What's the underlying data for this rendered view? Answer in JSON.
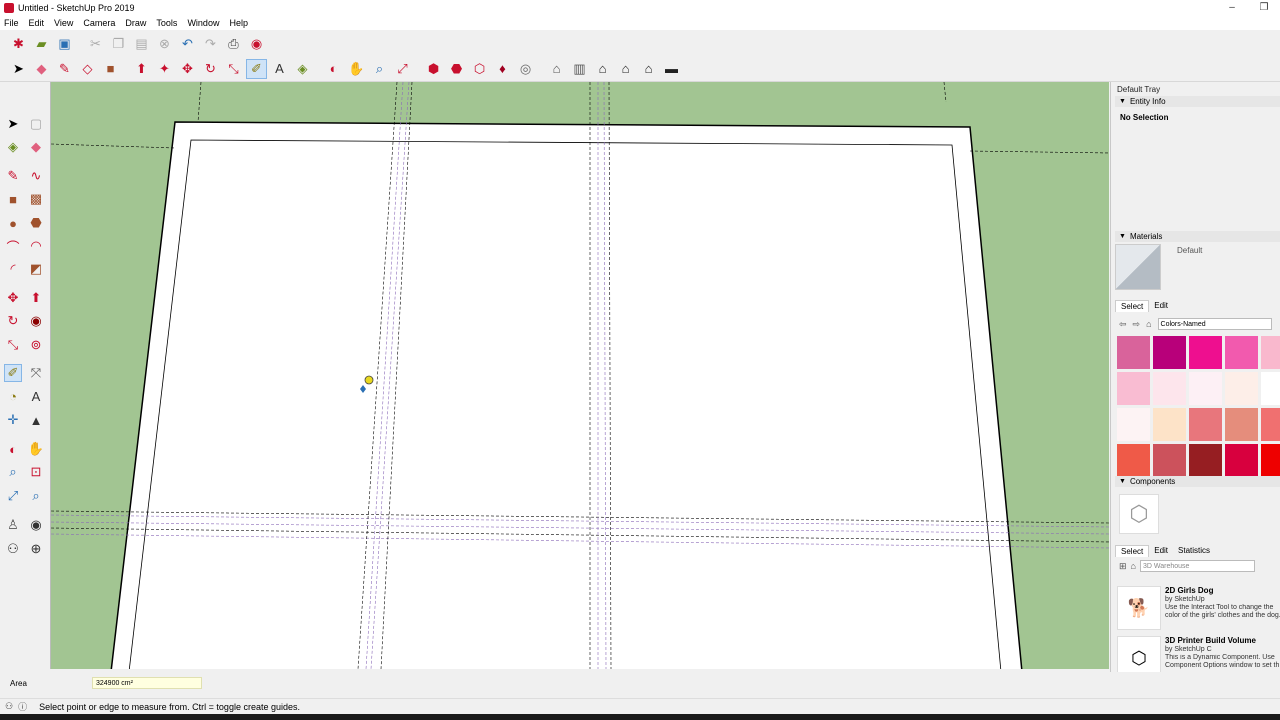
{
  "window": {
    "title": "Untitled - SketchUp Pro 2019",
    "minimize": "–",
    "restore": "❐"
  },
  "menu": [
    "File",
    "Edit",
    "View",
    "Camera",
    "Draw",
    "Tools",
    "Window",
    "Help"
  ],
  "toolbar1_icons": [
    "new-file-icon",
    "open-folder-icon",
    "save-icon",
    "cut-icon",
    "copy-icon",
    "paste-icon",
    "erase-icon",
    "undo-icon",
    "redo-icon",
    "print-icon",
    "model-info-icon"
  ],
  "toolbar2_icons": [
    "select-icon",
    "eraser-icon",
    "pencil-icon",
    "shapes-icon",
    "rectangle-icon",
    "push-pull-icon",
    "follow-me-icon",
    "move-icon",
    "rotate-icon",
    "scale-icon",
    "tape-measure-icon",
    "text-icon",
    "paint-bucket-icon",
    "orbit-icon",
    "pan-icon",
    "zoom-icon",
    "zoom-extents-icon",
    "warehouse-icon",
    "extension-icon",
    "share-icon",
    "ruby-icon",
    "account-icon",
    "iso-view-icon",
    "top-view-icon",
    "front-view-icon",
    "right-view-icon",
    "back-view-icon",
    "left-view-icon"
  ],
  "tray": {
    "title": "Default Tray",
    "entity_info": {
      "header": "Entity Info",
      "status": "No Selection"
    },
    "materials": {
      "header": "Materials",
      "current": "Default",
      "tabs": [
        "Select",
        "Edit"
      ],
      "collection": "Colors-Named",
      "swatches": [
        "#d9639b",
        "#b8007a",
        "#ee0f8f",
        "#f25aae",
        "#f9b8cd",
        "#f9bcd2",
        "#fde5ec",
        "#fdf0f5",
        "#fdeee8",
        "#ffffff",
        "#fdf3f4",
        "#fde3c8",
        "#e8767c",
        "#e58d7c",
        "#f07070",
        "#ef5a48",
        "#cc525c",
        "#961e22",
        "#d8003e",
        "#ee0000"
      ]
    },
    "components": {
      "header": "Components",
      "tabs": [
        "Select",
        "Edit",
        "Statistics"
      ],
      "search_placeholder": "3D Warehouse",
      "items": [
        {
          "name": "2D Girls Dog",
          "by": "by SketchUp",
          "desc1": "Use the Interact Tool to change the",
          "desc2": "color of the girls' clothes and the dog."
        },
        {
          "name": "3D Printer Build Volume",
          "by": "by SketchUp C",
          "desc1": "This is a Dynamic Component. Use",
          "desc2": "Component Options window to set th"
        }
      ]
    }
  },
  "measurements": {
    "label": "Area",
    "value": "324900 cm²"
  },
  "status": {
    "message": "Select point or edge to measure from.  Ctrl = toggle create guides."
  },
  "colors": {
    "viewport_bg": "#a2c592",
    "guide_color": "#8a6ab8"
  }
}
